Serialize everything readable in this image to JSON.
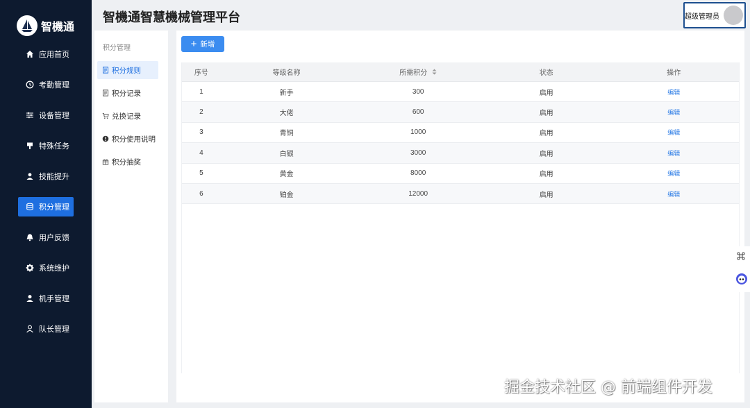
{
  "app": {
    "name": "智機通",
    "page_title": "智機通智慧機械管理平台"
  },
  "user": {
    "name": "超级管理员"
  },
  "sidebar": {
    "items": [
      {
        "label": "应用首页",
        "icon": "home-icon"
      },
      {
        "label": "考勤管理",
        "icon": "clock-icon"
      },
      {
        "label": "设备管理",
        "icon": "sliders-icon"
      },
      {
        "label": "特殊任务",
        "icon": "flag-icon"
      },
      {
        "label": "技能提升",
        "icon": "user-upgrade-icon"
      },
      {
        "label": "积分管理",
        "icon": "database-icon",
        "active": true
      },
      {
        "label": "用户反馈",
        "icon": "bell-icon"
      },
      {
        "label": "系统维护",
        "icon": "gear-icon"
      },
      {
        "label": "机手管理",
        "icon": "user-icon"
      },
      {
        "label": "队长管理",
        "icon": "user-outline-icon"
      }
    ]
  },
  "submenu": {
    "title": "积分管理",
    "items": [
      {
        "label": "积分规则",
        "icon": "rules-icon",
        "active": true
      },
      {
        "label": "积分记录",
        "icon": "record-icon"
      },
      {
        "label": "兑换记录",
        "icon": "cart-icon"
      },
      {
        "label": "积分使用说明",
        "icon": "info-icon"
      },
      {
        "label": "积分抽奖",
        "icon": "gift-icon"
      }
    ]
  },
  "toolbar": {
    "add_label": "新增"
  },
  "table": {
    "columns": [
      "序号",
      "等级名称",
      "所需积分",
      "状态",
      "操作"
    ],
    "rows": [
      {
        "no": "1",
        "name": "新手",
        "points": "300",
        "status": "启用",
        "action": "编辑"
      },
      {
        "no": "2",
        "name": "大佬",
        "points": "600",
        "status": "启用",
        "action": "编辑"
      },
      {
        "no": "3",
        "name": "青铜",
        "points": "1000",
        "status": "启用",
        "action": "编辑"
      },
      {
        "no": "4",
        "name": "白银",
        "points": "3000",
        "status": "启用",
        "action": "编辑"
      },
      {
        "no": "5",
        "name": "黄金",
        "points": "8000",
        "status": "启用",
        "action": "编辑"
      },
      {
        "no": "6",
        "name": "铂金",
        "points": "12000",
        "status": "启用",
        "action": "编辑"
      }
    ]
  },
  "watermark": "掘金技术社区 @ 前端组件开发",
  "colors": {
    "sidebar_bg": "#0d1a2f",
    "accent": "#1e6fe0",
    "link": "#2f7ee6"
  }
}
